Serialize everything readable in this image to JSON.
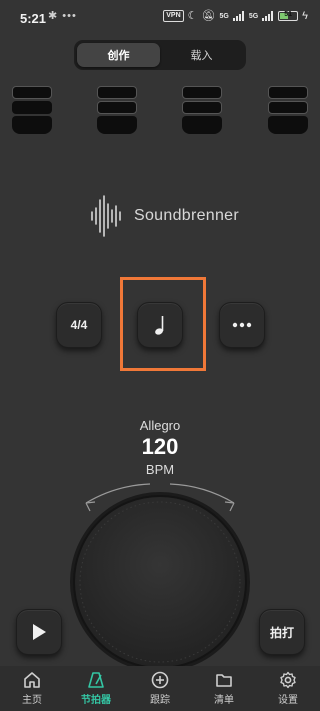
{
  "status_bar": {
    "time": "5:21",
    "dots": "✱ •••",
    "vpn": "VPN",
    "signal1": "5G",
    "signal2": "5G",
    "battery": "51"
  },
  "segment": {
    "tabs": [
      {
        "label": "创作",
        "active": true
      },
      {
        "label": "载入",
        "active": false
      }
    ]
  },
  "brand": {
    "name": "Soundbrenner"
  },
  "controls": {
    "time_signature": "4/4",
    "note_icon": "quarter-note-icon",
    "more_icon": "more-dots-icon"
  },
  "tempo": {
    "name": "Allegro",
    "value": "120",
    "unit": "BPM"
  },
  "actions": {
    "play_icon": "play-icon",
    "tap_label": "拍打"
  },
  "nav": {
    "items": [
      {
        "label": "主页",
        "icon": "home-icon",
        "active": false
      },
      {
        "label": "节拍器",
        "icon": "metronome-icon",
        "active": true
      },
      {
        "label": "跟踪",
        "icon": "plus-circle-icon",
        "active": false
      },
      {
        "label": "清单",
        "icon": "folder-icon",
        "active": false
      },
      {
        "label": "设置",
        "icon": "gear-icon",
        "active": false
      }
    ]
  },
  "colors": {
    "accent": "#34c6a4",
    "highlight": "#f07838",
    "background": "#343434"
  }
}
